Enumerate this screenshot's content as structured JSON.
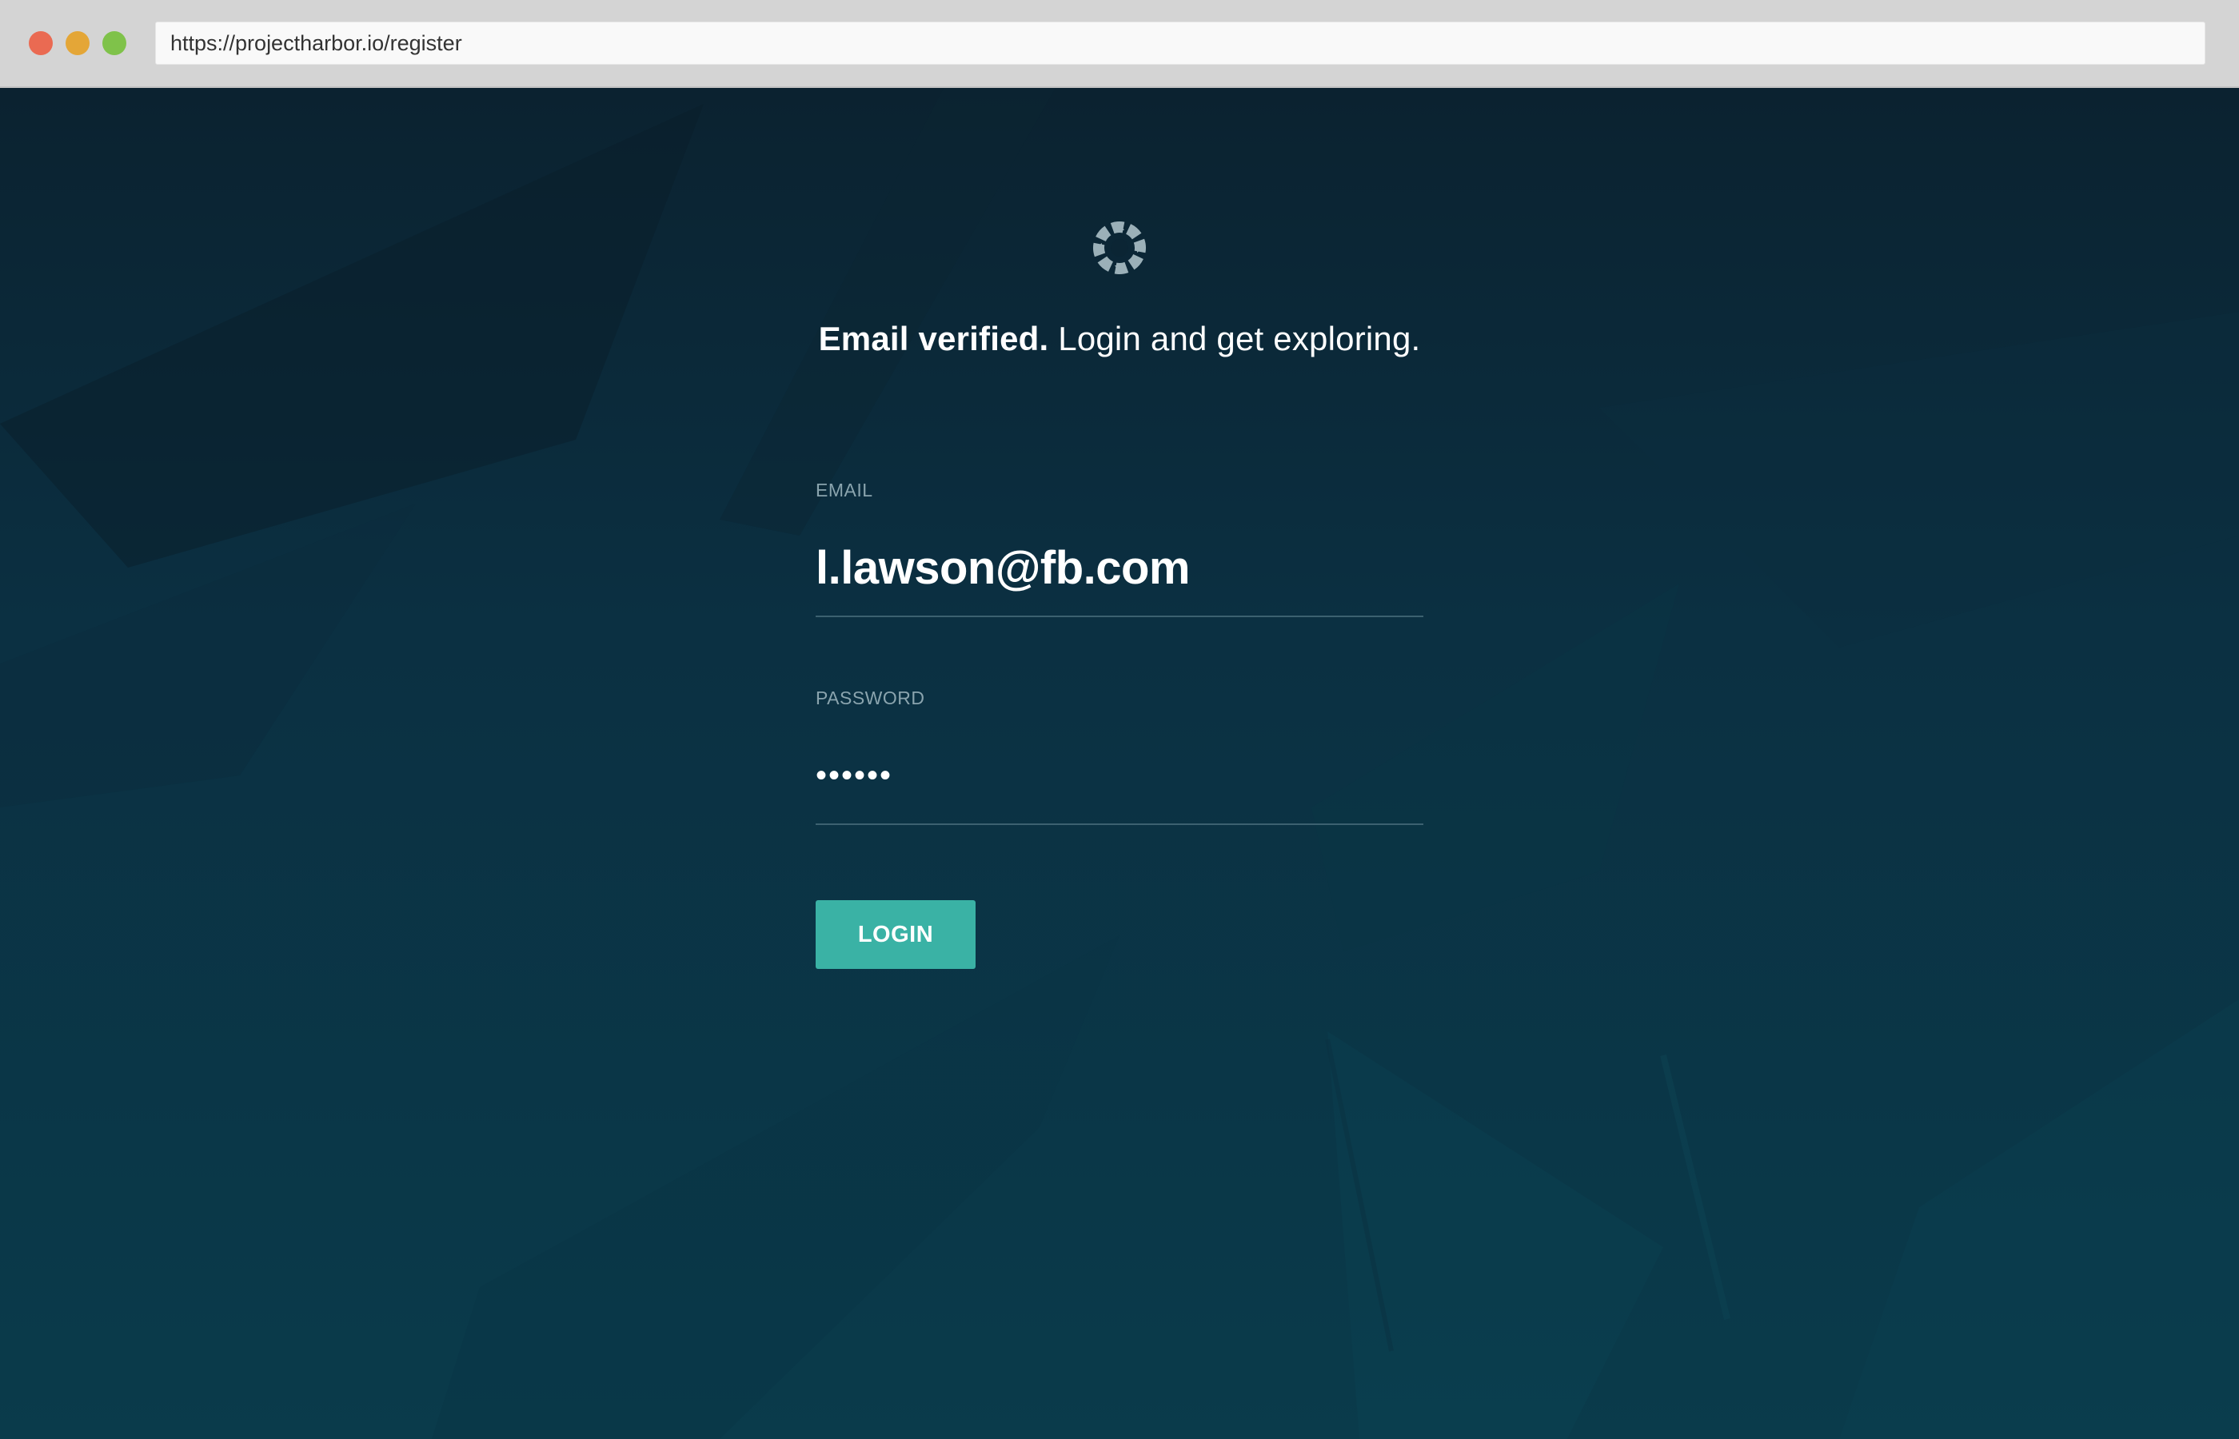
{
  "browser": {
    "url": "https://projectharbor.io/register"
  },
  "logo": {
    "icon": "lifebuoy-icon"
  },
  "headline": {
    "strong": "Email verified.",
    "rest": " Login and get exploring."
  },
  "form": {
    "email_label": "EMAIL",
    "email_value": "l.lawson@fb.com",
    "password_label": "PASSWORD",
    "password_value": "••••••",
    "login_label": "LOGIN"
  },
  "colors": {
    "accent": "#3ab2a5",
    "background": "#0b3042",
    "label": "#8aa4ae"
  }
}
